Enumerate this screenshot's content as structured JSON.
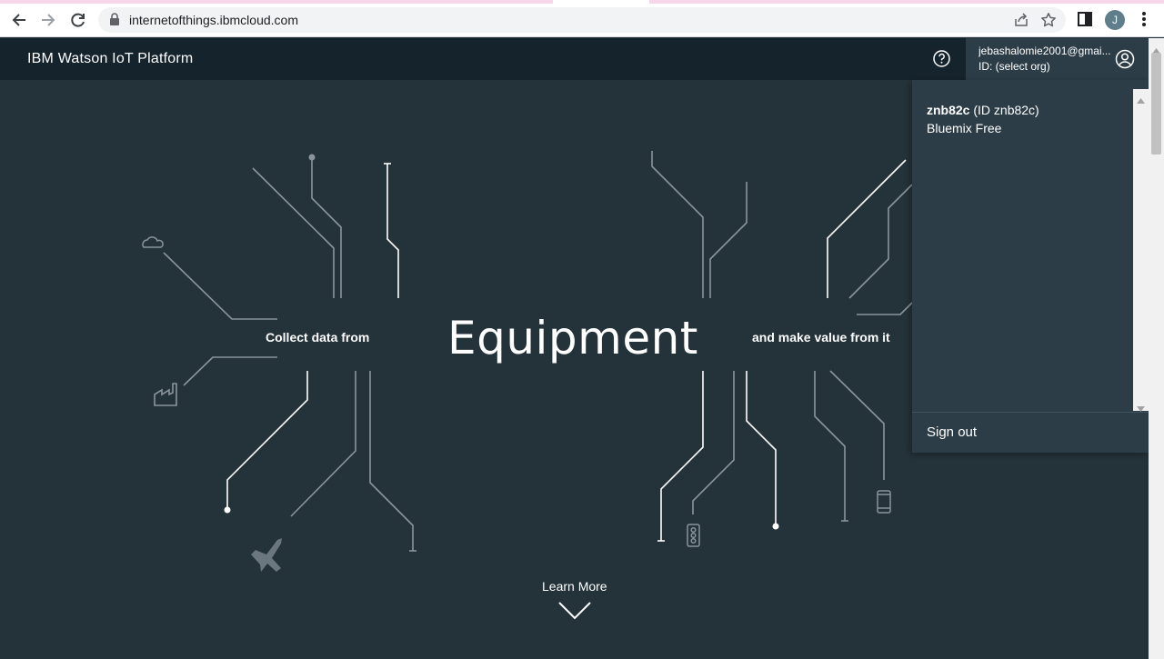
{
  "browser": {
    "url": "internetofthings.ibmcloud.com",
    "profile_initial": "J",
    "icons": [
      "back-arrow-icon",
      "forward-arrow-icon",
      "reload-icon",
      "lock-icon",
      "share-icon",
      "star-icon",
      "side-panel-icon",
      "more-vert-icon"
    ]
  },
  "header": {
    "title": "IBM Watson IoT Platform",
    "account_email": "jebashalomie2001@gmai...",
    "account_org": "ID: (select org)"
  },
  "hero": {
    "collect_text": "Collect data from",
    "headline": "Equipment",
    "value_text": "and make value from it",
    "learn_more": "Learn More"
  },
  "org_panel": {
    "org_name": "znb82c",
    "org_id_text": " (ID znb82c)",
    "plan": "Bluemix Free",
    "sign_out": "Sign out"
  },
  "colors": {
    "header_bg": "#15232c",
    "hero_bg": "#243239",
    "panel_bg": "#2c3d48",
    "line_white": "#ffffff",
    "line_gray": "#8a959c"
  }
}
